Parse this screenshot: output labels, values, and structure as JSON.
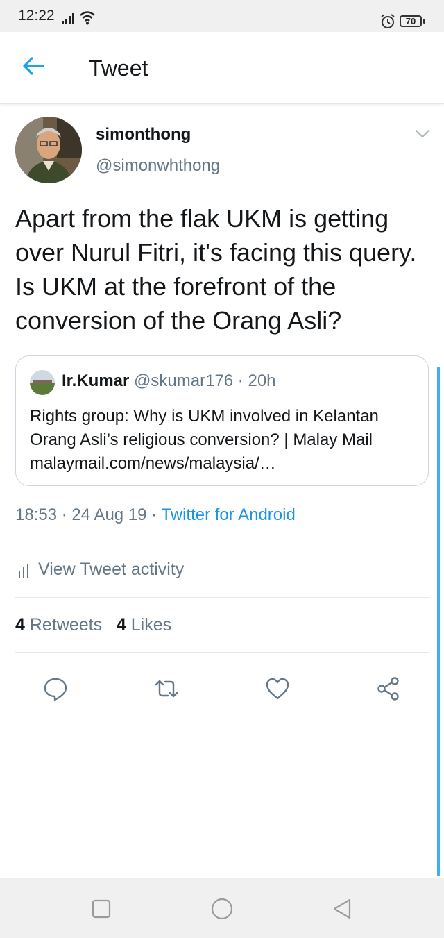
{
  "status_bar": {
    "time": "12:22",
    "battery": "70",
    "icons": [
      "signal-icon",
      "wifi-icon",
      "alarm-icon",
      "battery-icon"
    ]
  },
  "header": {
    "title": "Tweet",
    "back_icon": "arrow-left-icon"
  },
  "tweet": {
    "author_name": "simonthong",
    "author_handle": "@simonwhthong",
    "text": "Apart from the flak UKM is getting over Nurul Fitri, it's facing this query. Is UKM at the forefront of the conversion of the Orang Asli?",
    "quote": {
      "name": "Ir.Kumar",
      "handle": "@skumar176",
      "time": "20h",
      "line1": "Rights group: Why is UKM involved in Kelantan",
      "line2": "Orang Asli’s religious conversion? | Malay Mail",
      "line3": "malaymail.com/news/malaysia/…"
    },
    "time": "18:53",
    "date": "24 Aug 19",
    "source": "Twitter for Android",
    "separator": " · ",
    "activity_label": "View Tweet activity",
    "retweets_count": "4",
    "retweets_label": "Retweets",
    "likes_count": "4",
    "likes_label": "Likes"
  },
  "actions": [
    "reply-icon",
    "retweet-icon",
    "like-icon",
    "share-icon"
  ],
  "colors": {
    "accent": "#1da1f2",
    "link": "#1b95e0",
    "secondary_text": "#657786",
    "primary_text": "#14171a",
    "divider": "#e1e8ed"
  }
}
